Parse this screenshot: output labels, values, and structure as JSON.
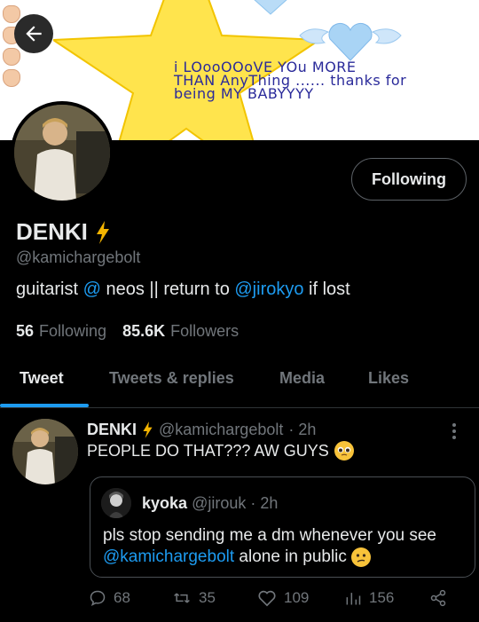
{
  "banner": {
    "text_line1": "i LOooOOoVE YOu MORE",
    "text_line2": "THAN AnyThing ...... thanks for",
    "text_line3": "being MY BABYYYY"
  },
  "profile": {
    "display_name": "DENKI",
    "handle": "@kamichargebolt",
    "bio_part1": "guitarist ",
    "bio_mention1": "@",
    "bio_part2": " neos || return to ",
    "bio_mention2": "@jirokyo",
    "bio_part3": " if lost",
    "following_count": "56",
    "following_label": "Following",
    "followers_count": "85.6K",
    "followers_label": "Followers",
    "follow_button_label": "Following"
  },
  "tabs": [
    {
      "label": "Tweet"
    },
    {
      "label": "Tweets & replies"
    },
    {
      "label": "Media"
    },
    {
      "label": "Likes"
    }
  ],
  "tweet": {
    "author_name": "DENKI",
    "author_handle": "@kamichargebolt",
    "time": "· 2h",
    "text": "PEOPLE DO THAT??? AW GUYS",
    "quote": {
      "author_name": "kyoka",
      "author_handle": "@jirouk",
      "time": "· 2h",
      "text_part1": "pls stop sending me a dm whenever you see ",
      "mention": "@kamichargebolt",
      "text_part2": " alone in public"
    },
    "replies": "68",
    "retweets": "35",
    "likes": "109",
    "views": "156"
  },
  "colors": {
    "accent": "#1d9bf0",
    "background": "#000000",
    "muted": "#71767b",
    "banner_star": "#ffe44d",
    "banner_text": "#2a2a9a"
  },
  "icons": [
    "arrow-left-icon",
    "lightning-bolt-icon",
    "more-vertical-icon",
    "reply-icon",
    "retweet-icon",
    "heart-icon",
    "analytics-icon",
    "share-icon",
    "pleading-face-emoji",
    "confused-face-emoji"
  ]
}
